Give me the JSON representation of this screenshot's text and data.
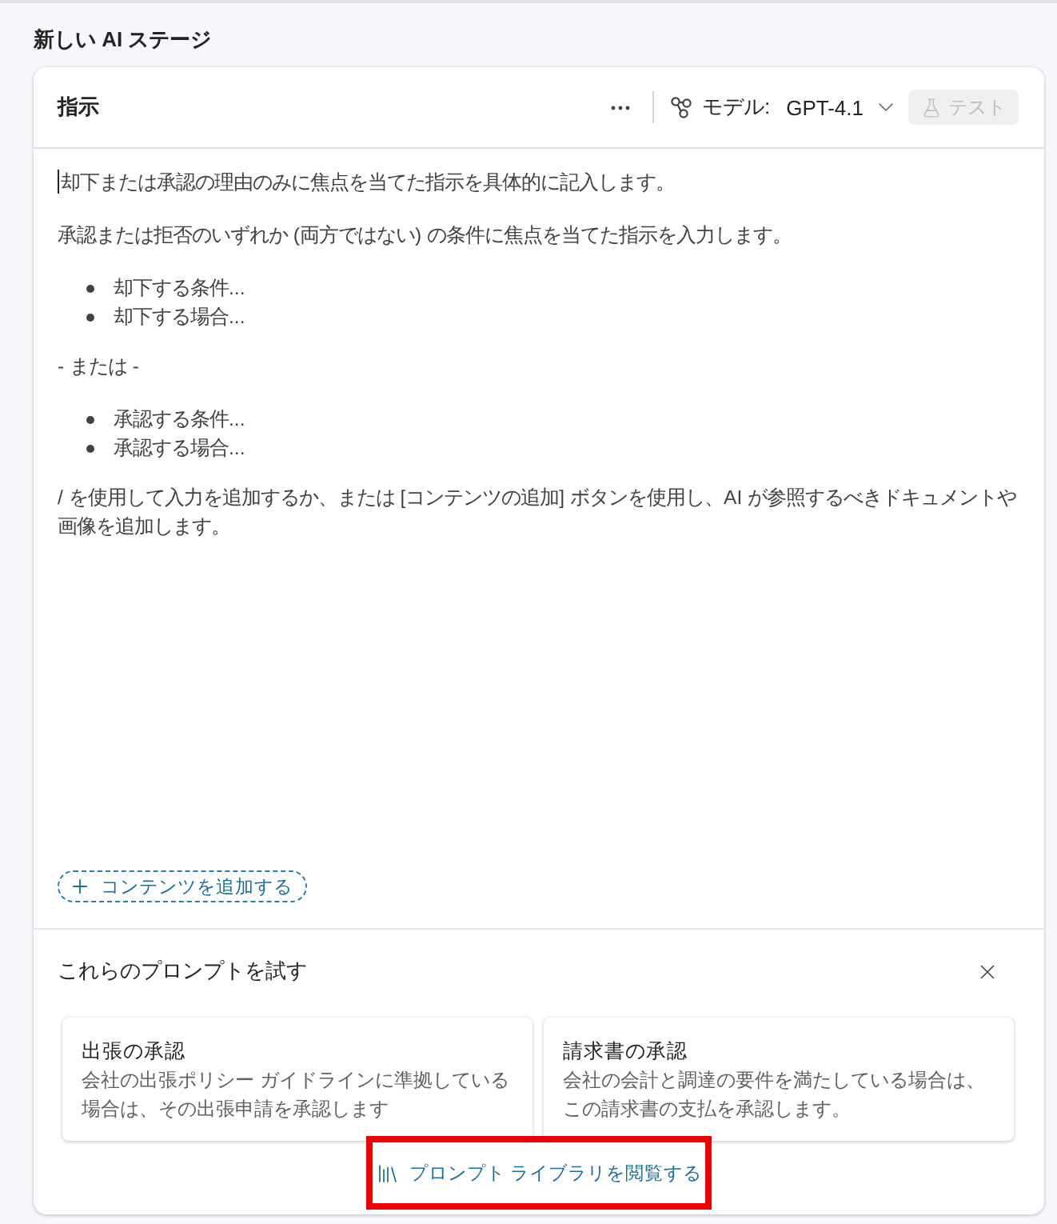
{
  "page": {
    "title": "新しい AI ステージ"
  },
  "instructions": {
    "title": "指示",
    "model": {
      "label": "モデル:",
      "value": "GPT-4.1"
    },
    "test_button": {
      "label": "テスト",
      "disabled": true
    }
  },
  "editor": {
    "focused": true,
    "blocks": [
      {
        "kind": "paragraph",
        "text": "却下または承認の理由のみに焦点を当てた指示を具体的に記入します。"
      },
      {
        "kind": "paragraph",
        "text": "承認または拒否のいずれか (両方ではない) の条件に焦点を当てた指示を入力します。"
      },
      {
        "kind": "list",
        "items": [
          "却下する条件...",
          "却下する場合..."
        ]
      },
      {
        "kind": "paragraph",
        "text": "- または -"
      },
      {
        "kind": "list",
        "items": [
          "承認する条件...",
          "承認する場合..."
        ]
      },
      {
        "kind": "paragraph",
        "text": "/ を使用して入力を追加するか、または [コンテンツの追加] ボタンを使用し、AI が参照するべきドキュメントや画像を追加します。"
      }
    ],
    "add_content_button": "コンテンツを追加する"
  },
  "suggestions": {
    "title": "これらのプロンプトを試す",
    "cards": [
      {
        "title": "出張の承認",
        "description": "会社の出張ポリシー ガイドラインに準拠している場合は、その出張申請を承認します"
      },
      {
        "title": "請求書の承認",
        "description": "会社の会計と調達の要件を満たしている場合は、この請求書の支払を承認します。"
      }
    ],
    "library_link": {
      "label": "プロンプト ライブラリを閲覧する",
      "highlighted": true
    }
  }
}
